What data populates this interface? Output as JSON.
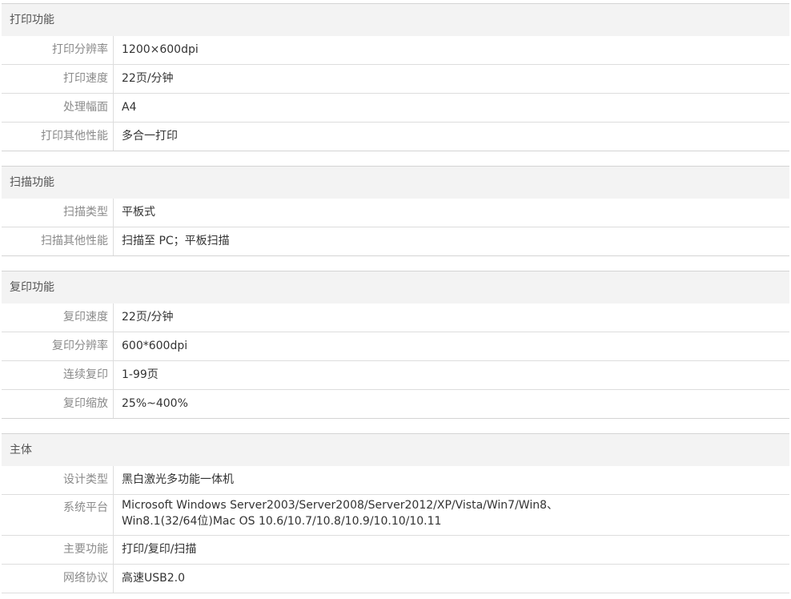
{
  "sections": [
    {
      "title": "打印功能",
      "rows": [
        {
          "label": "打印分辨率",
          "value": "1200×600dpi"
        },
        {
          "label": "打印速度",
          "value": "22页/分钟"
        },
        {
          "label": "处理幅面",
          "value": "A4"
        },
        {
          "label": "打印其他性能",
          "value": "多合一打印"
        }
      ]
    },
    {
      "title": "扫描功能",
      "rows": [
        {
          "label": "扫描类型",
          "value": "平板式"
        },
        {
          "label": "扫描其他性能",
          "value": "扫描至 PC；平板扫描"
        }
      ]
    },
    {
      "title": "复印功能",
      "rows": [
        {
          "label": "复印速度",
          "value": "22页/分钟"
        },
        {
          "label": "复印分辨率",
          "value": "600*600dpi"
        },
        {
          "label": "连续复印",
          "value": "1-99页"
        },
        {
          "label": "复印缩放",
          "value": "25%~400%"
        }
      ]
    },
    {
      "title": "主体",
      "rows": [
        {
          "label": "设计类型",
          "value": "黑白激光多功能一体机"
        },
        {
          "label": "系统平台",
          "value_line1": "Microsoft Windows Server2003/Server2008/Server2012/XP/Vista/Win7/Win8、",
          "value_line2": "Win8.1(32/64位)Mac OS 10.6/10.7/10.8/10.9/10.10/10.11"
        },
        {
          "label": "主要功能",
          "value": "打印/复印/扫描"
        },
        {
          "label": "网络协议",
          "value": "高速USB2.0"
        }
      ]
    }
  ]
}
